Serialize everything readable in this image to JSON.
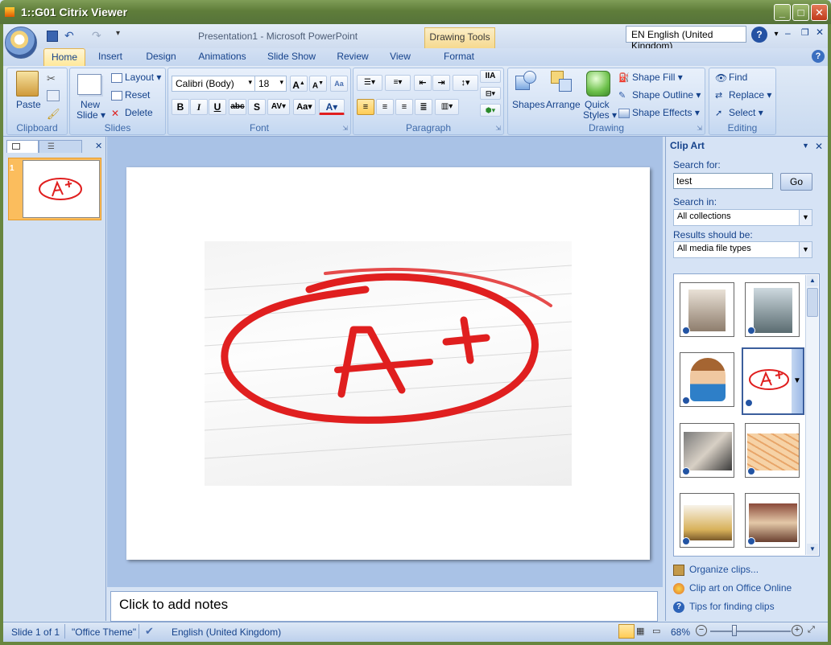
{
  "window": {
    "title": "1::G01 Citrix Viewer"
  },
  "app": {
    "title": "Presentation1 - Microsoft PowerPoint",
    "contextual_tab": "Drawing Tools",
    "language": "EN English (United Kingdom)"
  },
  "tabs": [
    "Home",
    "Insert",
    "Design",
    "Animations",
    "Slide Show",
    "Review",
    "View",
    "Format"
  ],
  "ribbon": {
    "clipboard": {
      "label": "Clipboard",
      "paste": "Paste"
    },
    "slides": {
      "label": "Slides",
      "new_slide": "New",
      "new_slide2": "Slide",
      "layout": "Layout",
      "reset": "Reset",
      "delete": "Delete"
    },
    "font": {
      "label": "Font",
      "name": "Calibri (Body)",
      "size": "18"
    },
    "paragraph": {
      "label": "Paragraph"
    },
    "drawing": {
      "label": "Drawing",
      "shapes": "Shapes",
      "arrange": "Arrange",
      "quick": "Quick",
      "styles": "Styles",
      "shape_fill": "Shape Fill",
      "shape_outline": "Shape Outline",
      "shape_effects": "Shape Effects"
    },
    "editing": {
      "label": "Editing",
      "find": "Find",
      "replace": "Replace",
      "select": "Select"
    }
  },
  "slides_pane": {
    "slide_number": "1"
  },
  "notes": {
    "placeholder": "Click to add notes"
  },
  "clipart": {
    "title": "Clip Art",
    "search_label": "Search for:",
    "search_value": "test",
    "go": "Go",
    "search_in_label": "Search in:",
    "search_in_value": "All collections",
    "results_label": "Results should be:",
    "results_value": "All media file types",
    "links": [
      "Organize clips...",
      "Clip art on Office Online",
      "Tips for finding clips"
    ]
  },
  "status": {
    "slide": "Slide 1 of 1",
    "theme": "\"Office Theme\"",
    "language": "English (United Kingdom)",
    "zoom": "68%"
  },
  "colors": {
    "accent_red": "#e01f1f",
    "ribbon_blue": "#15428b",
    "xp_green": "#6b8a41"
  }
}
